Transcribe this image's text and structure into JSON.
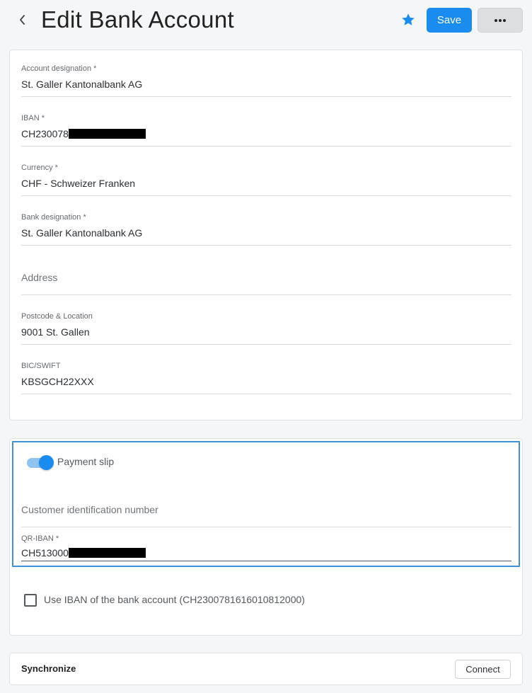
{
  "header": {
    "title": "Edit Bank Account",
    "save_label": "Save",
    "accent_color": "#1a8cf0"
  },
  "bank_account": {
    "account_designation": {
      "label": "Account designation *",
      "value": "St. Galler Kantonalbank AG"
    },
    "iban": {
      "label": "IBAN *",
      "value": "CH230078"
    },
    "currency": {
      "label": "Currency *",
      "value": "CHF - Schweizer Franken"
    },
    "bank_designation": {
      "label": "Bank designation *",
      "value": "St. Galler Kantonalbank AG"
    },
    "address": {
      "placeholder": "Address"
    },
    "postcode_location": {
      "label": "Postcode & Location",
      "value": "9001 St. Gallen"
    },
    "bic_swift": {
      "label": "BIC/SWIFT",
      "value": "KBSGCH22XXX"
    }
  },
  "payment_slip": {
    "toggle_label": "Payment slip",
    "toggle_on": true,
    "customer_id": {
      "placeholder": "Customer identification number"
    },
    "qr_iban": {
      "label": "QR-IBAN *",
      "value": "CH513000"
    },
    "use_iban_label": "Use IBAN of the bank account (CH2300781616010812000)",
    "use_iban_checked": false
  },
  "sync": {
    "title": "Synchronize",
    "connect_label": "Connect"
  }
}
